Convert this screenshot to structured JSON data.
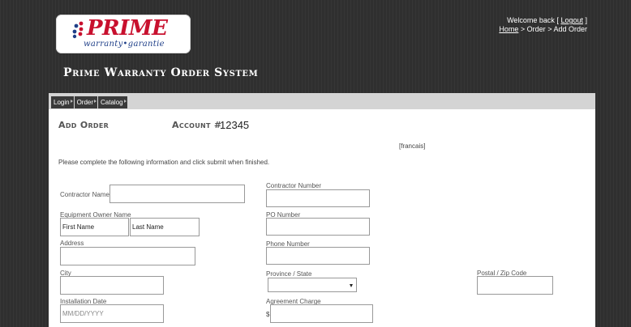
{
  "brand": {
    "name": "PRIME",
    "tagline": "warranty•garantie",
    "dot_colors": [
      "#c8102e",
      "#1f3f88",
      "#c8102e",
      "#1f3f88",
      "#c8102e",
      "#1f3f88"
    ]
  },
  "header": {
    "welcome_prefix": "Welcome back [",
    "logout_label": "Logout",
    "welcome_suffix": "]",
    "breadcrumb": {
      "home": "Home",
      "sep1": ">",
      "order": "Order",
      "sep2": ">",
      "current": "Add Order"
    },
    "system_title": "Prime Warranty Order System"
  },
  "nav": {
    "items": [
      {
        "label": "Login"
      },
      {
        "label": "Order"
      },
      {
        "label": "Catalog"
      }
    ]
  },
  "page": {
    "title": "Add Order",
    "account_label": "Account #",
    "account_number": "12345",
    "language_link": "[francais]",
    "instructions": "Please complete the following information and click submit when finished."
  },
  "form": {
    "contractor_name_label": "Contractor Name",
    "contractor_name_value": "",
    "contractor_number_label": "Contractor Number",
    "contractor_number_value": "",
    "owner_label": "Equipment Owner Name",
    "first_name_placeholder": "First Name",
    "last_name_placeholder": "Last Name",
    "po_number_label": "PO Number",
    "po_number_value": "",
    "address_label": "Address",
    "address_value": "",
    "phone_label": "Phone Number",
    "phone_value": "",
    "city_label": "City",
    "city_value": "",
    "province_label": "Province / State",
    "province_selected": "",
    "postal_label": "Postal / Zip Code",
    "postal_value": "",
    "install_date_label": "Installation Date",
    "install_date_placeholder": "MM/DD/YYYY",
    "agreement_label": "Agreement Charge",
    "currency_symbol": "$",
    "agreement_value": ""
  }
}
